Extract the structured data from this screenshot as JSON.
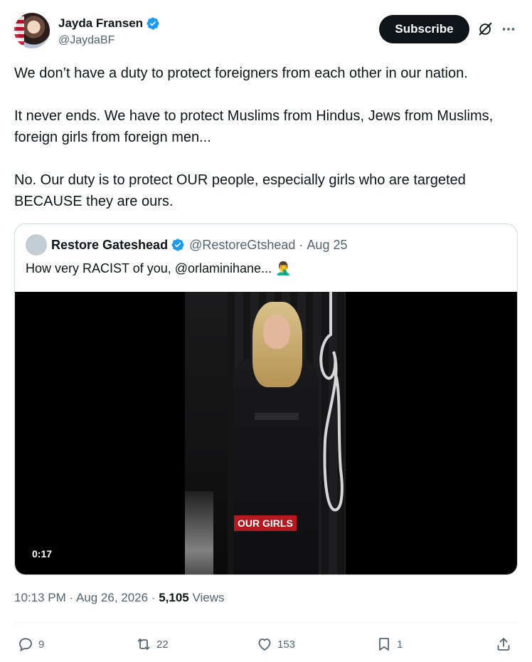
{
  "author": {
    "display_name": "Jayda Fransen",
    "handle": "@JaydaBF",
    "verified_icon": "verified-badge-icon"
  },
  "header": {
    "subscribe_label": "Subscribe",
    "grok_icon": "grok-icon",
    "more_icon": "more-options-icon"
  },
  "tweet": {
    "paragraphs": [
      "We don’t have a duty to protect foreigners from each other in our nation.",
      "It never ends. We have to protect Muslims from Hindus, Jews from Muslims, foreign girls from foreign men...",
      "No. Our duty is to protect OUR people, especially girls who are targeted BECAUSE they are ours."
    ]
  },
  "quote": {
    "name": "Restore Gateshead",
    "handle": "@RestoreGtshead",
    "dot": "·",
    "date": "Aug 25",
    "text": "How very RACIST of you, @orlaminihane... 🤦‍♂️",
    "video": {
      "caption": "OUR GIRLS",
      "duration": "0:17"
    }
  },
  "meta": {
    "time": "10:13 PM",
    "sep1": " · ",
    "date": "Aug 26, 2026",
    "sep2": " · ",
    "views_count": "5,105",
    "views_label": " Views"
  },
  "actions": {
    "reply_count": "9",
    "retweet_count": "22",
    "like_count": "153",
    "bookmark_count": "1"
  },
  "colors": {
    "text": "#0f1419",
    "secondary": "#536471",
    "verified": "#1d9bf0",
    "caption_bg": "#b3191f"
  }
}
